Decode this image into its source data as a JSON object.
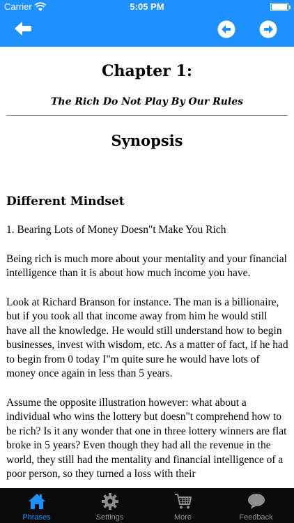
{
  "status_bar": {
    "carrier": "Carrier",
    "time": "5:05 PM"
  },
  "nav": {
    "back_icon": "back-arrow-icon",
    "prev_icon": "circle-arrow-left-icon",
    "next_icon": "circle-arrow-right-icon"
  },
  "content": {
    "chapter_title": "Chapter 1:",
    "chapter_subtitle": "The Rich Do Not Play By Our Rules",
    "section_title": "Synopsis",
    "heading": "Different Mindset",
    "paragraphs": [
      "1. Bearing Lots of Money Doesn\"t Make You Rich",
      "Being rich is much more about your mentality and your financial intelligence than it is about how much income you have.",
      "Look at Richard Branson for instance. The man is a billionaire, but if you took all that income away from him he would still have all the knowledge. He would still understand how to begin businesses, invest with wisdom, etc. As a matter of fact, if he had to begin from 0 today I\"m quite sure he would have lots of money once again in less than 5 years.",
      "Assume the opposite illustration however: what about a individual who wins the lottery but doesn\"t comprehend how to be rich? Is it any wonder that one in three lottery winners are flat broke in 5 years? Even though they had all the revenue in the world, they still had the mentality and financial intelligence of a poor person, so they turned a loss with their"
    ]
  },
  "tabs": [
    {
      "label": "Phrases",
      "icon": "home-icon",
      "active": true
    },
    {
      "label": "Settings",
      "icon": "gear-icon",
      "active": false
    },
    {
      "label": "More",
      "icon": "cart-icon",
      "active": false
    },
    {
      "label": "Feedback",
      "icon": "speech-bubble-icon",
      "active": false
    }
  ],
  "colors": {
    "accent": "#1E90FF",
    "tabbar": "#0b0b0b",
    "inactive_tab": "#8e8e8e"
  }
}
